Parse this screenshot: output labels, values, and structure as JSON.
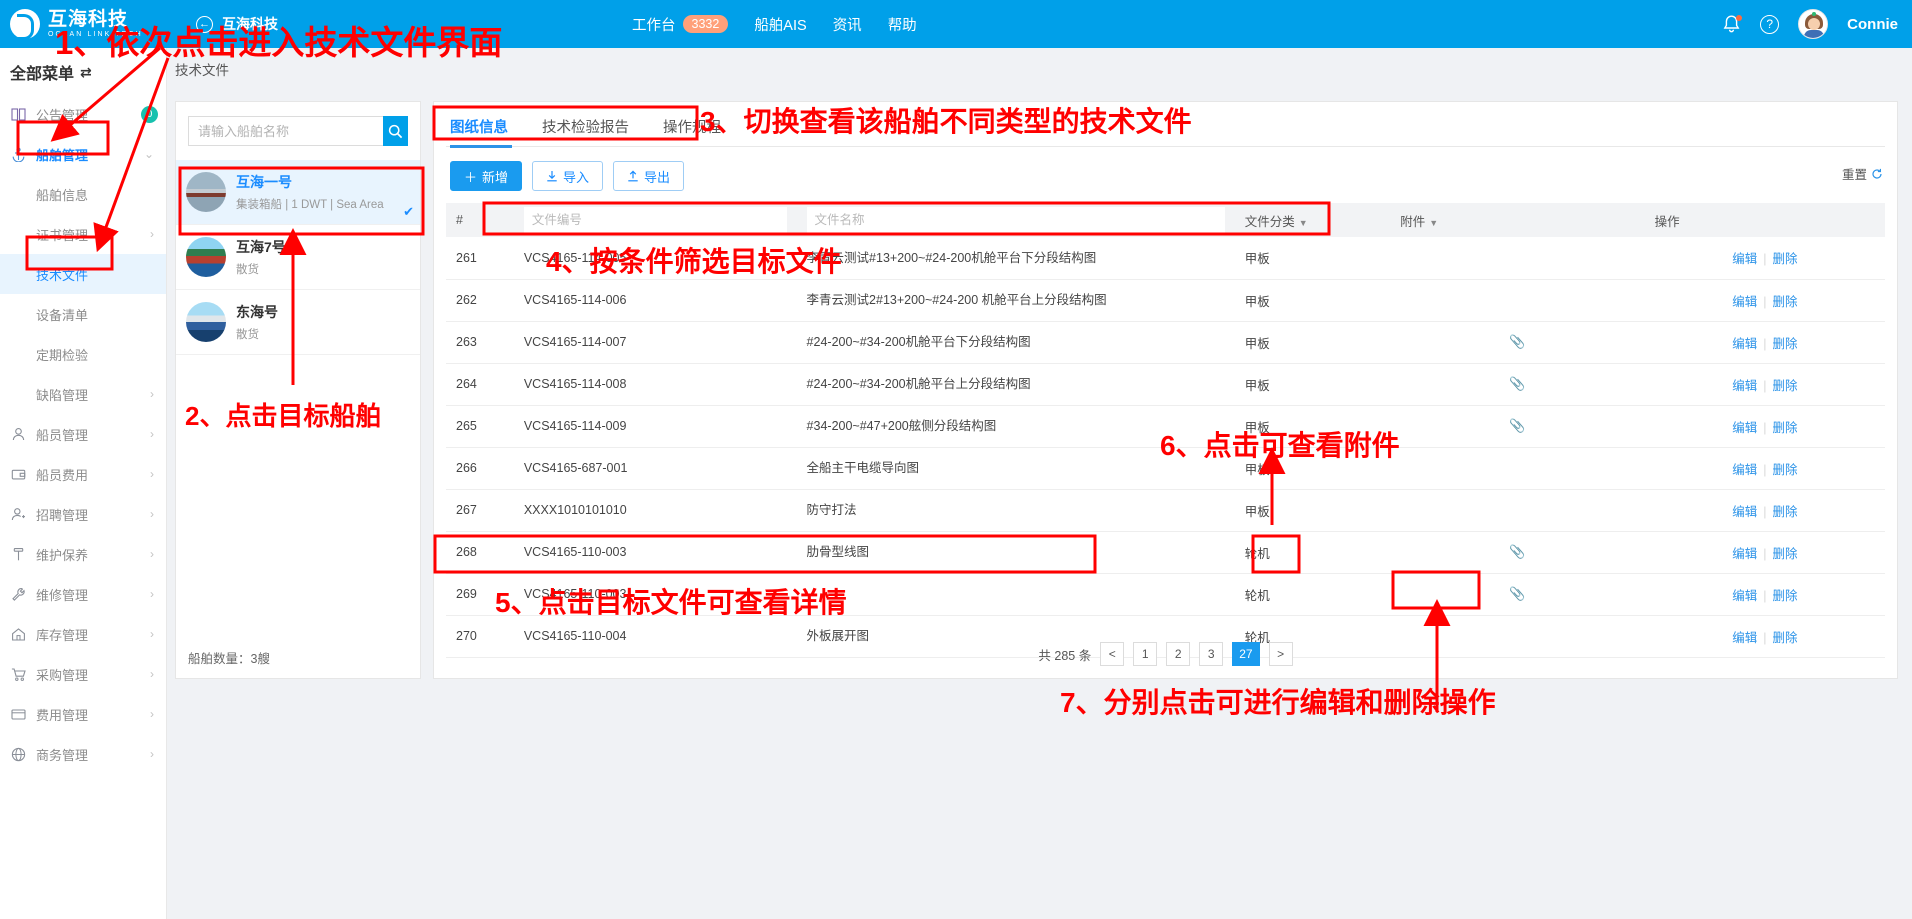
{
  "topbar": {
    "logo_cn": "互海科技",
    "logo_en": "OCEAN LINK TECH",
    "back_icon": "←",
    "back_label": "互海科技",
    "nav": [
      {
        "label": "工作台",
        "badge": "3332"
      },
      {
        "label": "船舶AIS",
        "badge": ""
      },
      {
        "label": "资讯",
        "badge": ""
      },
      {
        "label": "帮助",
        "badge": ""
      }
    ],
    "username": "Connie"
  },
  "sidebar": {
    "title": "全部菜单",
    "swap_icon": "⇄",
    "items": [
      {
        "label": "公告管理",
        "icon": "book-icon",
        "arrow": "",
        "count": "0",
        "level": "top",
        "state": ""
      },
      {
        "label": "船舶管理",
        "icon": "anchor-icon",
        "arrow": "⌄",
        "count": "",
        "level": "top",
        "state": "active-parent"
      },
      {
        "label": "船舶信息",
        "icon": "",
        "arrow": "",
        "count": "",
        "level": "sub",
        "state": ""
      },
      {
        "label": "证书管理",
        "icon": "",
        "arrow": "›",
        "count": "",
        "level": "sub",
        "state": ""
      },
      {
        "label": "技术文件",
        "icon": "",
        "arrow": "",
        "count": "",
        "level": "sub",
        "state": "active-sub"
      },
      {
        "label": "设备清单",
        "icon": "",
        "arrow": "",
        "count": "",
        "level": "sub",
        "state": ""
      },
      {
        "label": "定期检验",
        "icon": "",
        "arrow": "",
        "count": "",
        "level": "sub",
        "state": ""
      },
      {
        "label": "缺陷管理",
        "icon": "",
        "arrow": "›",
        "count": "",
        "level": "sub",
        "state": ""
      },
      {
        "label": "船员管理",
        "icon": "user-icon",
        "arrow": "›",
        "count": "",
        "level": "top",
        "state": ""
      },
      {
        "label": "船员费用",
        "icon": "wallet-icon",
        "arrow": "›",
        "count": "",
        "level": "top",
        "state": ""
      },
      {
        "label": "招聘管理",
        "icon": "user-add-icon",
        "arrow": "›",
        "count": "",
        "level": "top",
        "state": ""
      },
      {
        "label": "维护保养",
        "icon": "hammer-icon",
        "arrow": "›",
        "count": "",
        "level": "top",
        "state": ""
      },
      {
        "label": "维修管理",
        "icon": "wrench-icon",
        "arrow": "›",
        "count": "",
        "level": "top",
        "state": ""
      },
      {
        "label": "库存管理",
        "icon": "home-icon",
        "arrow": "›",
        "count": "",
        "level": "top",
        "state": ""
      },
      {
        "label": "采购管理",
        "icon": "cart-icon",
        "arrow": "›",
        "count": "",
        "level": "top",
        "state": ""
      },
      {
        "label": "费用管理",
        "icon": "money-icon",
        "arrow": "›",
        "count": "",
        "level": "top",
        "state": ""
      },
      {
        "label": "商务管理",
        "icon": "globe-icon",
        "arrow": "›",
        "count": "",
        "level": "top",
        "state": ""
      }
    ]
  },
  "breadcrumb": "技术文件",
  "ship_panel": {
    "search_placeholder": "请输入船舶名称",
    "search_value": "",
    "ships": [
      {
        "name": "互海一号",
        "sub": "集装箱船 | 1 DWT | Sea Area",
        "selected": true
      },
      {
        "name": "互海7号",
        "sub": "散货",
        "selected": false
      },
      {
        "name": "东海号",
        "sub": "散货",
        "selected": false
      }
    ],
    "count_label": "船舶数量：3艘"
  },
  "table_panel": {
    "tabs": [
      {
        "label": "图纸信息",
        "active": true
      },
      {
        "label": "技术检验报告",
        "active": false
      },
      {
        "label": "操作规程",
        "active": false
      }
    ],
    "buttons": [
      {
        "label": "新增",
        "icon": "plus-icon",
        "style": "primary"
      },
      {
        "label": "导入",
        "icon": "import-icon",
        "style": "outline"
      },
      {
        "label": "导出",
        "icon": "export-icon",
        "style": "outline"
      }
    ],
    "reset_label": "重置",
    "reset_icon": "refresh-icon",
    "columns": {
      "index": "#",
      "code_placeholder": "文件编号",
      "name_placeholder": "文件名称",
      "category": "文件分类",
      "attachment": "附件",
      "operation": "操作"
    },
    "rows": [
      {
        "idx": "261",
        "code": "VCS4165-114-005",
        "name": "李青云测试#13+200~#24-200机舱平台下分段结构图",
        "cat": "甲板",
        "att": false,
        "edit": "编辑",
        "del": "删除"
      },
      {
        "idx": "262",
        "code": "VCS4165-114-006",
        "name": "李青云测试2#13+200~#24-200 机舱平台上分段结构图",
        "cat": "甲板",
        "att": false,
        "edit": "编辑",
        "del": "删除"
      },
      {
        "idx": "263",
        "code": "VCS4165-114-007",
        "name": "#24-200~#34-200机舱平台下分段结构图",
        "cat": "甲板",
        "att": true,
        "edit": "编辑",
        "del": "删除"
      },
      {
        "idx": "264",
        "code": "VCS4165-114-008",
        "name": "#24-200~#34-200机舱平台上分段结构图",
        "cat": "甲板",
        "att": true,
        "edit": "编辑",
        "del": "删除"
      },
      {
        "idx": "265",
        "code": "VCS4165-114-009",
        "name": "#34-200~#47+200舷侧分段结构图",
        "cat": "甲板",
        "att": true,
        "edit": "编辑",
        "del": "删除"
      },
      {
        "idx": "266",
        "code": "VCS4165-687-001",
        "name": "全船主干电缆导向图",
        "cat": "甲板",
        "att": false,
        "edit": "编辑",
        "del": "删除"
      },
      {
        "idx": "267",
        "code": "XXXX1010101010",
        "name": "防守打法",
        "cat": "甲板",
        "att": false,
        "edit": "编辑",
        "del": "删除"
      },
      {
        "idx": "268",
        "code": "VCS4165-110-003",
        "name": "肋骨型线图",
        "cat": "轮机",
        "att": true,
        "edit": "编辑",
        "del": "删除"
      },
      {
        "idx": "269",
        "code": "VCS4165-110-003",
        "name": "",
        "cat": "轮机",
        "att": true,
        "edit": "编辑",
        "del": "删除"
      },
      {
        "idx": "270",
        "code": "VCS4165-110-004",
        "name": "外板展开图",
        "cat": "轮机",
        "att": false,
        "edit": "编辑",
        "del": "删除"
      }
    ],
    "pagination": {
      "total_label": "共 285 条",
      "prev": "<",
      "pages": [
        "1",
        "2",
        "3"
      ],
      "current": "27",
      "next": ">"
    }
  },
  "annotations": [
    {
      "id": "a1",
      "text": "1、依次点击进入技术文件界面"
    },
    {
      "id": "a2",
      "text": "2、点击目标船舶"
    },
    {
      "id": "a3",
      "text": "3、切换查看该船舶不同类型的技术文件"
    },
    {
      "id": "a4",
      "text": "4、按条件筛选目标文件"
    },
    {
      "id": "a5",
      "text": "5、点击目标文件可查看详情"
    },
    {
      "id": "a6",
      "text": "6、点击可查看附件"
    },
    {
      "id": "a7",
      "text": "7、分别点击可进行编辑和删除操作"
    }
  ]
}
